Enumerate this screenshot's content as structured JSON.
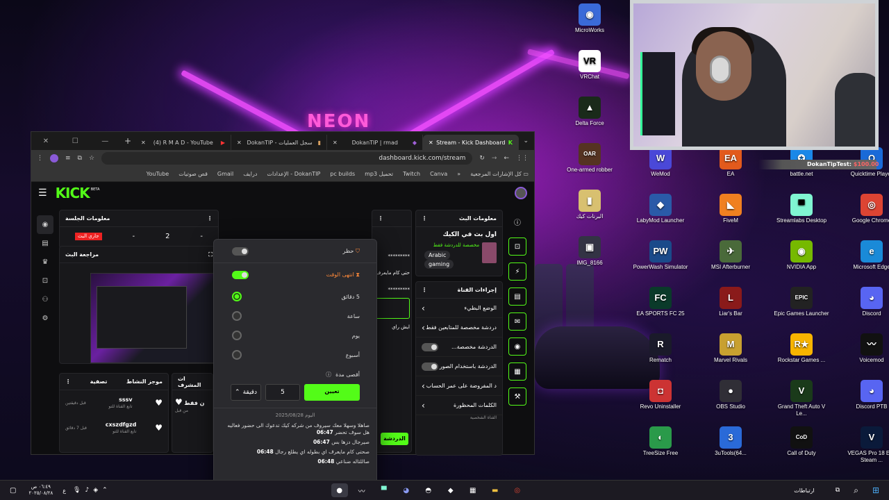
{
  "desktop": {
    "col1": [
      {
        "label": "MicroWorks",
        "icon": "microworks-icon",
        "color": "#3a6ad8",
        "glyph": "◉"
      },
      {
        "label": "VRChat",
        "icon": "vrchat-icon",
        "color": "#ffffff",
        "glyph": "VR"
      },
      {
        "label": "Delta Force",
        "icon": "delta-force-icon",
        "color": "#1a2a1a",
        "glyph": "▲"
      },
      {
        "label": "One-armed robber",
        "icon": "one-armed-robber-icon",
        "color": "#553322",
        "glyph": "OAR"
      },
      {
        "label": "البرنات كيك",
        "icon": "folder-icon",
        "color": "#d8c070",
        "glyph": "▮"
      },
      {
        "label": "IMG_8166",
        "icon": "image-icon",
        "color": "#333344",
        "glyph": "▣"
      }
    ],
    "col2": [
      {
        "label": "WeMod",
        "icon": "wemod-icon",
        "color": "#4a48d8",
        "glyph": "W"
      },
      {
        "label": "LabyMod Launcher",
        "icon": "labymod-icon",
        "color": "#2a5aa8",
        "glyph": "◆"
      },
      {
        "label": "PowerWash Simulator",
        "icon": "powerwash-icon",
        "color": "#1a4a8a",
        "glyph": "PW"
      },
      {
        "label": "EA SPORTS FC 25",
        "icon": "fc25-icon",
        "color": "#0a3a2a",
        "glyph": "FC"
      },
      {
        "label": "Rematch",
        "icon": "rematch-icon",
        "color": "#1a1a2a",
        "glyph": "R"
      },
      {
        "label": "Revo Uninstaller",
        "icon": "revo-icon",
        "color": "#cc3333",
        "glyph": "◘"
      },
      {
        "label": "TreeSize Free",
        "icon": "treesize-icon",
        "color": "#2a9a4a",
        "glyph": "◐"
      }
    ],
    "col3": [
      {
        "label": "EA",
        "icon": "ea-icon",
        "color": "#e25a1c",
        "glyph": "EA"
      },
      {
        "label": "FiveM",
        "icon": "fivem-icon",
        "color": "#f08020",
        "glyph": "◣"
      },
      {
        "label": "MSI Afterburner",
        "icon": "msi-icon",
        "color": "#4a6a3a",
        "glyph": "✈"
      },
      {
        "label": "Liar's Bar",
        "icon": "liars-bar-icon",
        "color": "#8a1a1a",
        "glyph": "L"
      },
      {
        "label": "Marvel Rivals",
        "icon": "marvel-rivals-icon",
        "color": "#c8a030",
        "glyph": "M"
      },
      {
        "label": "OBS Studio",
        "icon": "obs-icon",
        "color": "#302e36",
        "glyph": "●"
      },
      {
        "label": "3uTools(64...",
        "icon": "3utools-icon",
        "color": "#2a6ad8",
        "glyph": "3"
      }
    ],
    "col4": [
      {
        "label": "battle.net",
        "icon": "battlenet-icon",
        "color": "#1a88e8",
        "glyph": "✪"
      },
      {
        "label": "Streamlabs Desktop",
        "icon": "streamlabs-icon",
        "color": "#80f5d2",
        "glyph": "▀"
      },
      {
        "label": "NVIDIA App",
        "icon": "nvidia-icon",
        "color": "#76b900",
        "glyph": "◉"
      },
      {
        "label": "Epic Games Launcher",
        "icon": "epic-icon",
        "color": "#222222",
        "glyph": "EPIC"
      },
      {
        "label": "Rockstar Games ...",
        "icon": "rockstar-icon",
        "color": "#f8b400",
        "glyph": "R★"
      },
      {
        "label": "Grand Theft Auto V Le...",
        "icon": "gta-icon",
        "color": "#1a3a1a",
        "glyph": "V"
      },
      {
        "label": "Call of Duty",
        "icon": "cod-icon",
        "color": "#111111",
        "glyph": "CoD"
      }
    ],
    "col5": [
      {
        "label": "Quicktime Player",
        "icon": "quicktime-icon",
        "color": "#1a6ad8",
        "glyph": "Q"
      },
      {
        "label": "Google Chrome",
        "icon": "chrome-icon",
        "color": "#dd4433",
        "glyph": "◎"
      },
      {
        "label": "Microsoft Edge",
        "icon": "edge-icon",
        "color": "#1a8ad8",
        "glyph": "e"
      },
      {
        "label": "Discord",
        "icon": "discord-icon",
        "color": "#5865f2",
        "glyph": "◕"
      },
      {
        "label": "Voicemod",
        "icon": "voicemod-icon",
        "color": "#111111",
        "glyph": "〰"
      },
      {
        "label": "Discord PTB",
        "icon": "discord-ptb-icon",
        "color": "#5865f2",
        "glyph": "◕"
      },
      {
        "label": "VEGAS Pro 18 Edit Steam ...",
        "icon": "vegas-icon",
        "color": "#0a1a3a",
        "glyph": "V"
      }
    ]
  },
  "alert": {
    "name": "DokanTipTest:",
    "amount": "$100.00"
  },
  "browser": {
    "tabs": [
      {
        "label": "(4) R M A D - YouTube",
        "icon": "youtube-icon"
      },
      {
        "label": "DokanTIP - سجل العمليات",
        "icon": "dokantip-icon"
      },
      {
        "label": "DokanTIP | rmad",
        "icon": "dokantip-icon"
      },
      {
        "label": "Stream - Kick Dashboard",
        "icon": "kick-icon"
      }
    ],
    "url": "dashboard.kick.com/stream",
    "bookmarks": [
      "Canva",
      "Twitch",
      "تحميل mp3",
      "pc builds",
      "DokanTIP - الإعدادات",
      "درايف",
      "Gmail",
      "قص صوتيات",
      "YouTube"
    ],
    "all_bookmarks": "كل الإشارات المرجعية"
  },
  "kick": {
    "logo": "KICK",
    "beta": "BETA",
    "session": {
      "title": "معلومات الجلسة",
      "live": "جاري البث",
      "stats": [
        "-",
        "2",
        "-"
      ]
    },
    "preview": {
      "title": "مراجعة البث"
    },
    "activity": {
      "title": "موجز النشاط",
      "filter": "تصفية",
      "items": [
        {
          "user": "sssv",
          "action": "تابع القناة للتو",
          "time": "قبل دقيقتين"
        },
        {
          "user": "cxszdfgzd",
          "action": "تابع القناة للتو",
          "time": "قبل 7 دقائق"
        }
      ]
    },
    "mod": {
      "title": "ات المشرف",
      "item": "ن فقط",
      "sub": "من قبل"
    },
    "chat": {
      "masked1": "*********",
      "line": "حتى كام مايعرف",
      "masked2": "*********",
      "input_hint": "ايش راي",
      "send": "الدردشة"
    },
    "streaminfo": {
      "title": "معلومات البث",
      "stream_title": "اول بث في الكيك",
      "category": "مخصصة للدردشة فقط",
      "tags": [
        "Arabic",
        "gaming"
      ]
    },
    "channel_actions": {
      "title": "إجراءات القناة",
      "items": [
        {
          "label": "الوضع البطيء",
          "control": "arrow"
        },
        {
          "label": "دردشة مخصصة للمتابعين فقط",
          "control": "arrow"
        },
        {
          "label": "الدردشة مخصصة...",
          "control": "toggle"
        },
        {
          "label": "الدردشة باستخدام الصور",
          "control": "toggle"
        },
        {
          "label": "د المفروضة على عمر الحساب",
          "control": "arrow"
        },
        {
          "label": "الكلمات المحظورة",
          "control": "arrow"
        }
      ],
      "footer": "القناة الشخصية"
    }
  },
  "popup": {
    "ban": "حظر",
    "timeout": "انتهى الوقت",
    "options": [
      {
        "label": "5 دقائق",
        "selected": true
      },
      {
        "label": "ساعة",
        "selected": false
      },
      {
        "label": "يوم",
        "selected": false
      },
      {
        "label": "أسبوع",
        "selected": false
      }
    ],
    "max_label": "أقصى مدة",
    "duration_value": "5",
    "unit": "دقيقة",
    "apply": "تعيين",
    "date_sep": "اليوم 2025/08/28",
    "chat": [
      {
        "time": "06:47",
        "text": "صاهلا وسهلا معك سيروف من شركه كيك تدعوك الى حضور فعاليه هل سوف تحضر"
      },
      {
        "time": "06:47",
        "text": "صيرجال دزها بس"
      },
      {
        "time": "06:48",
        "text": "صحتى كام مايعرف اي بطوله اي يطلع رجال"
      },
      {
        "time": "06:48",
        "text": "صاللتاله ضناعي"
      }
    ]
  },
  "taskbar": {
    "right_label": "ارتباطات",
    "time": "٠٦:٤٩ ص",
    "date": "٢٠٢٥/٠٨/٢٨"
  }
}
